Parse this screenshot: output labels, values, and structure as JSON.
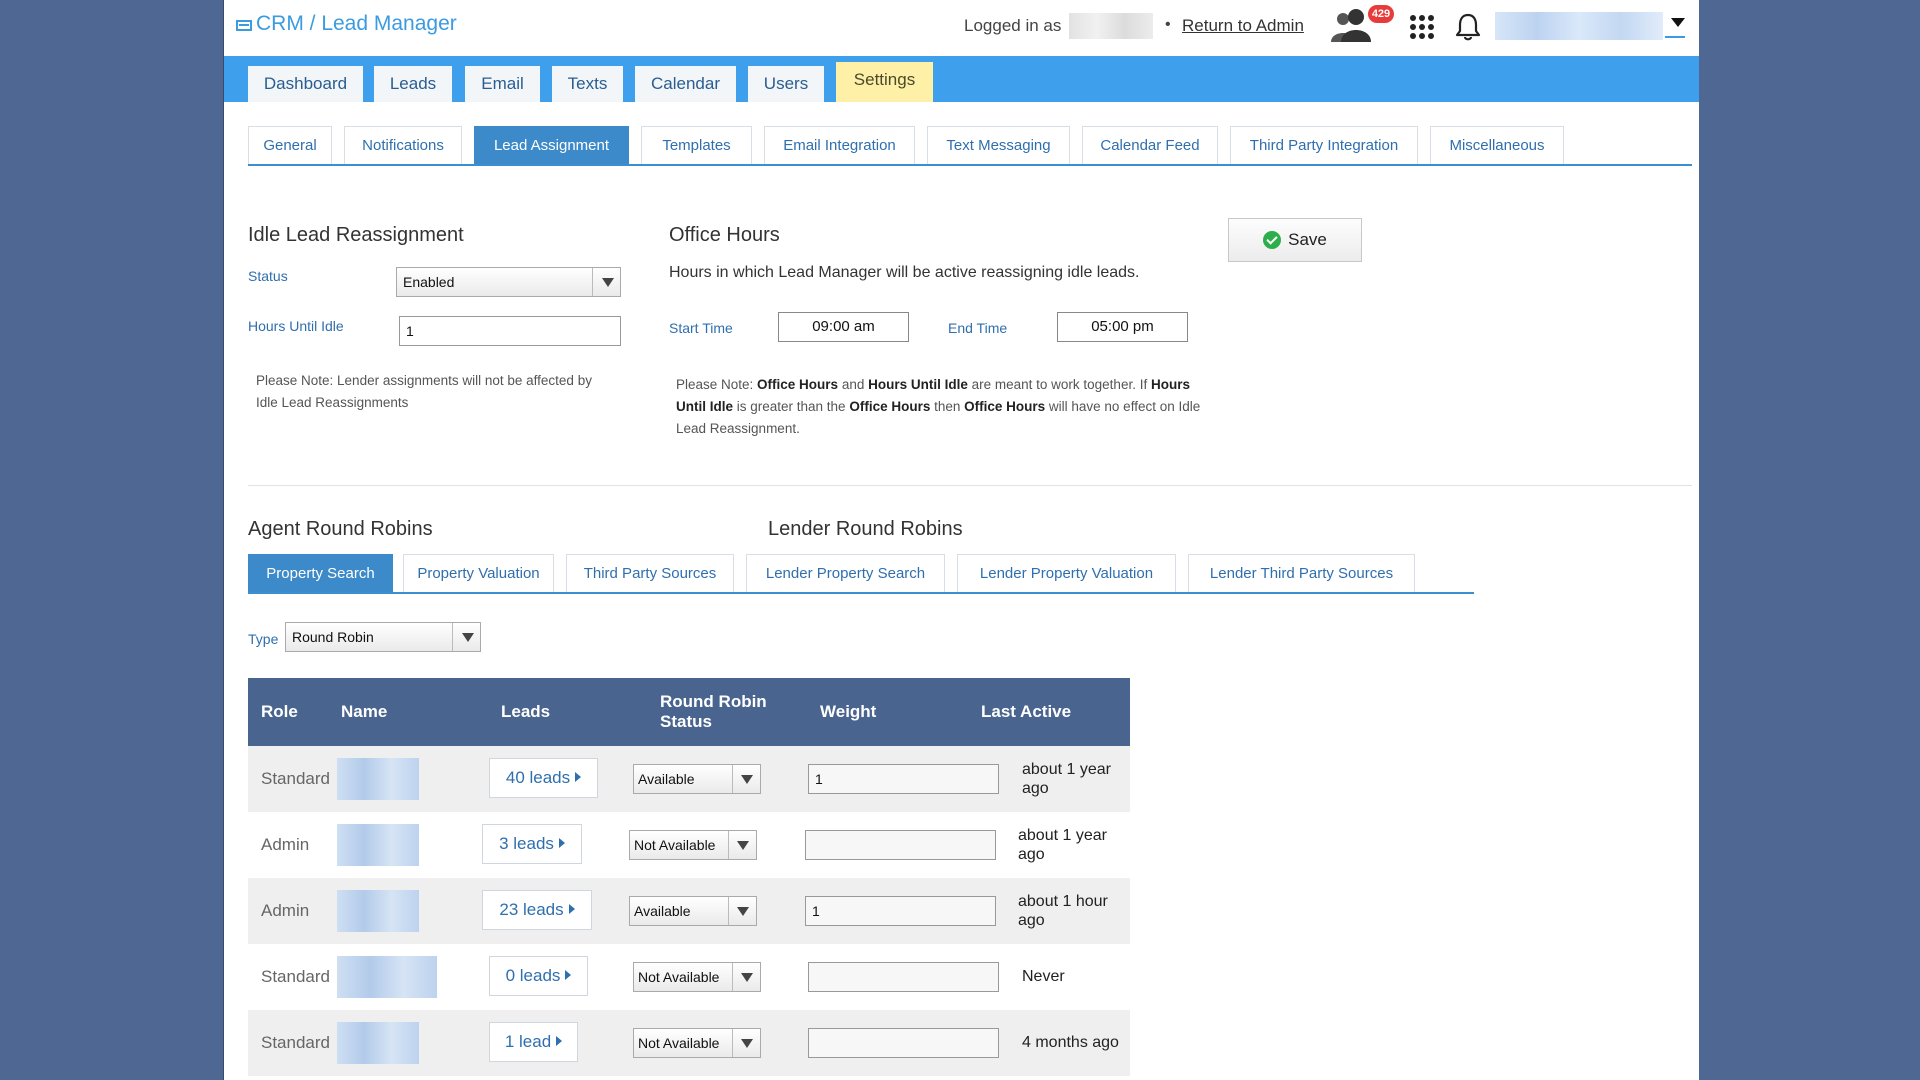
{
  "header": {
    "brand": "CRM / Lead Manager",
    "logged_in_label": "Logged in as",
    "separator": "•",
    "return_link": "Return to Admin",
    "badge_count": "429"
  },
  "main_nav": [
    {
      "label": "Dashboard"
    },
    {
      "label": "Leads"
    },
    {
      "label": "Email"
    },
    {
      "label": "Texts"
    },
    {
      "label": "Calendar"
    },
    {
      "label": "Users"
    },
    {
      "label": "Settings",
      "active": true
    }
  ],
  "sub_nav": [
    {
      "label": "General"
    },
    {
      "label": "Notifications"
    },
    {
      "label": "Lead Assignment",
      "active": true
    },
    {
      "label": "Templates"
    },
    {
      "label": "Email Integration"
    },
    {
      "label": "Text Messaging"
    },
    {
      "label": "Calendar Feed"
    },
    {
      "label": "Third Party Integration"
    },
    {
      "label": "Miscellaneous"
    }
  ],
  "idle": {
    "title": "Idle Lead Reassignment",
    "status_label": "Status",
    "status_value": "Enabled",
    "hours_label": "Hours Until Idle",
    "hours_value": "1",
    "note": "Please Note: Lender assignments will not be affected by Idle Lead Reassignments"
  },
  "office": {
    "title": "Office Hours",
    "description": "Hours in which Lead Manager will be active reassigning idle leads.",
    "start_label": "Start Time",
    "start_value": "09:00 am",
    "end_label": "End Time",
    "end_value": "05:00 pm",
    "note": {
      "p1": "Please Note: ",
      "b1": "Office Hours",
      "p2": " and ",
      "b2": "Hours Until Idle",
      "p3": " are meant to work together. If ",
      "b3": "Hours Until Idle",
      "p4": " is greater than the ",
      "b4": "Office Hours",
      "p5": " then ",
      "b5": "Office Hours",
      "p6": " will have no effect on Idle Lead Reassignment."
    }
  },
  "save_label": "Save",
  "agent_rr_title": "Agent Round Robins",
  "lender_rr_title": "Lender Round Robins",
  "rr_tabs": [
    {
      "label": "Property Search",
      "active": true
    },
    {
      "label": "Property Valuation"
    },
    {
      "label": "Third Party Sources"
    },
    {
      "label": "Lender Property Search"
    },
    {
      "label": "Lender Property Valuation"
    },
    {
      "label": "Lender Third Party Sources"
    }
  ],
  "type_label": "Type",
  "type_value": "Round Robin",
  "table": {
    "headers": {
      "role": "Role",
      "name": "Name",
      "leads": "Leads",
      "rr_status": "Round Robin Status",
      "weight": "Weight",
      "last_active": "Last Active"
    },
    "rows": [
      {
        "role": "Standard",
        "leads": "40 leads",
        "status": "Available",
        "weight": "1",
        "last_active": "about 1 year ago"
      },
      {
        "role": "Admin",
        "leads": "3 leads",
        "status": "Not Available",
        "weight": "",
        "last_active": "about 1 year ago"
      },
      {
        "role": "Admin",
        "leads": "23 leads",
        "status": "Available",
        "weight": "1",
        "last_active": "about 1 hour ago"
      },
      {
        "role": "Standard",
        "leads": "0 leads",
        "status": "Not Available",
        "weight": "",
        "last_active": "Never"
      },
      {
        "role": "Standard",
        "leads": "1 lead",
        "status": "Not Available",
        "weight": "",
        "last_active": "4 months ago"
      }
    ]
  }
}
